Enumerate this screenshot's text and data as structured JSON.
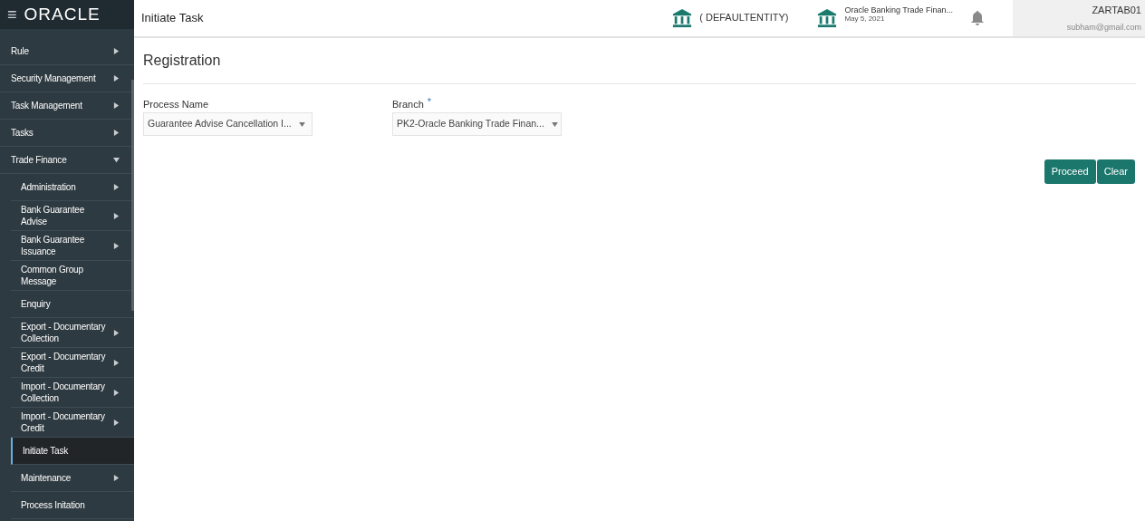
{
  "header": {
    "logo": "ORACLE",
    "menu_glyph": "≡",
    "page_title": "Initiate Task",
    "entity": "( DEFAULTENTITY)",
    "branch_name": "Oracle Banking Trade Finan...",
    "branch_date": "May 5, 2021",
    "user": "ZARTAB01",
    "email": "subham@gmail.com"
  },
  "sidebar": {
    "items": [
      {
        "label": "Rule",
        "submenu": true,
        "expanded": false,
        "selected": false
      },
      {
        "label": "Security Management",
        "submenu": true,
        "expanded": false,
        "selected": false
      },
      {
        "label": "Task Management",
        "submenu": true,
        "expanded": false,
        "selected": false
      },
      {
        "label": "Tasks",
        "submenu": true,
        "expanded": false,
        "selected": false
      },
      {
        "label": "Trade Finance",
        "submenu": true,
        "expanded": true,
        "selected": false,
        "children": [
          {
            "label": "Administration",
            "submenu": true,
            "expanded": false,
            "selected": false
          },
          {
            "label": "Bank Guarantee Advise",
            "submenu": true,
            "expanded": false,
            "selected": false
          },
          {
            "label": "Bank Guarantee Issuance",
            "submenu": true,
            "expanded": false,
            "selected": false
          },
          {
            "label": "Common Group Message",
            "submenu": false,
            "expanded": false,
            "selected": false
          },
          {
            "label": "Enquiry",
            "submenu": false,
            "expanded": false,
            "selected": false
          },
          {
            "label": "Export - Documentary Collection",
            "submenu": true,
            "expanded": false,
            "selected": false
          },
          {
            "label": "Export - Documentary Credit",
            "submenu": true,
            "expanded": false,
            "selected": false
          },
          {
            "label": "Import - Documentary Collection",
            "submenu": true,
            "expanded": false,
            "selected": false
          },
          {
            "label": "Import - Documentary Credit",
            "submenu": true,
            "expanded": false,
            "selected": false
          },
          {
            "label": "Initiate Task",
            "submenu": false,
            "expanded": false,
            "selected": true
          },
          {
            "label": "Maintenance",
            "submenu": true,
            "expanded": false,
            "selected": false
          },
          {
            "label": "Process Initation",
            "submenu": false,
            "expanded": false,
            "selected": false
          }
        ]
      }
    ]
  },
  "form": {
    "title": "Registration",
    "fields": [
      {
        "label": "Process Name",
        "value": "Guarantee Advise Cancellation I..."
      },
      {
        "label": "Branch",
        "required_mark": "*",
        "value": "PK2-Oracle Banking Trade Finan..."
      }
    ],
    "buttons": [
      "Proceed",
      "Clear"
    ]
  }
}
